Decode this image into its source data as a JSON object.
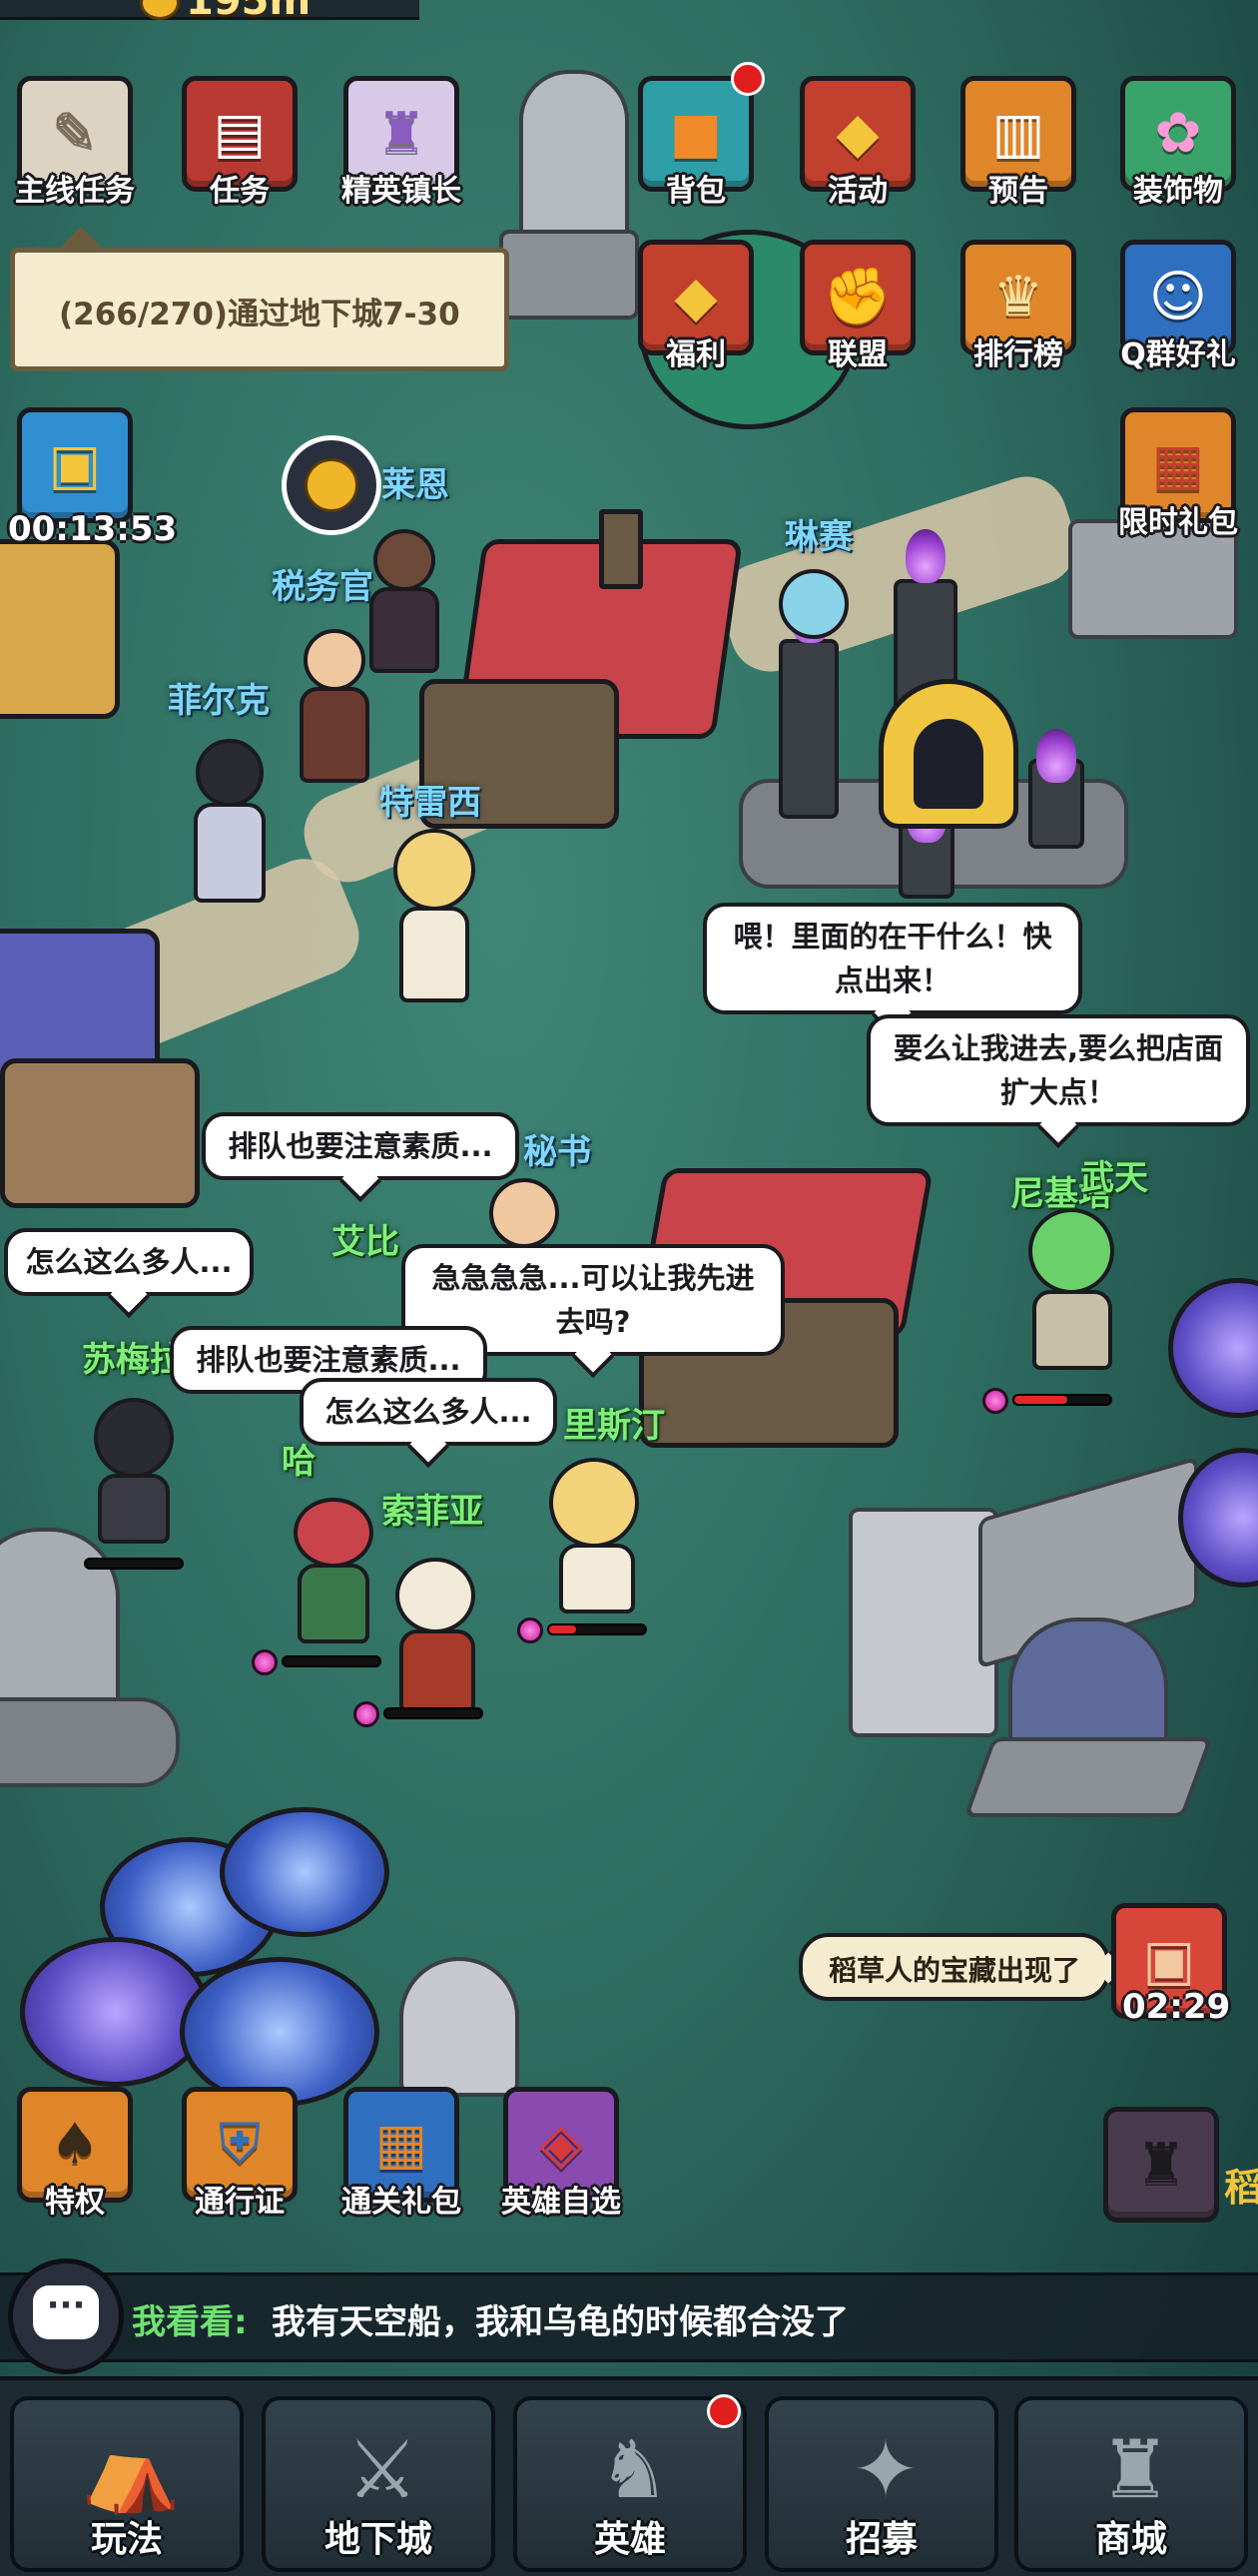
{
  "top_bar": {
    "currency_value": "195m",
    "currency_icon": "gold-coin-icon"
  },
  "left_top_buttons": [
    {
      "label": "主线任务",
      "icon": "quest-scroll-icon"
    },
    {
      "label": "任务",
      "icon": "red-book-icon"
    },
    {
      "label": "精英镇长",
      "icon": "elite-mayor-icon"
    }
  ],
  "quest_tooltip": "(266/270)通过地下城7-30",
  "chest_timer": {
    "icon": "treasure-chest-icon",
    "time": "00:13:53"
  },
  "right_buttons_row1": [
    {
      "label": "背包",
      "icon": "backpack-icon",
      "badge": true
    },
    {
      "label": "活动",
      "icon": "banner-shield-icon"
    },
    {
      "label": "预告",
      "icon": "open-book-icon"
    },
    {
      "label": "装饰物",
      "icon": "decoration-bush-icon"
    }
  ],
  "right_buttons_row2": [
    {
      "label": "福利",
      "icon": "welfare-banner-icon"
    },
    {
      "label": "联盟",
      "icon": "alliance-fist-icon"
    },
    {
      "label": "排行榜",
      "icon": "trophy-icon"
    },
    {
      "label": "Q群好礼",
      "icon": "qq-gift-icon"
    }
  ],
  "limited_gift": {
    "label": "限时礼包",
    "icon": "gift-box-icon"
  },
  "npc_names": {
    "tax_officer": "税务官",
    "laien": "莱恩",
    "lin_sai": "琳赛",
    "fei_er_ke": "菲尔克",
    "te_lei_xi": "特雷西",
    "secretary": "秘书",
    "ai_bi": "艾比",
    "su_mei_la": "苏梅拉",
    "suo_fei_ya": "索菲亚",
    "li_si_ting": "里斯汀",
    "ha": "哈",
    "ni_ji_ta": "尼基塔",
    "wu_tian": "武天"
  },
  "bubbles": {
    "shout_top": "喂！里面的在干什么！快点出来！",
    "expand_shop": "要么让我进去,要么把店面扩大点！",
    "queue_quality_1": "排队也要注意素质...",
    "so_many_1": "怎么这么多人...",
    "hurry": "急急急急...可以让我先进去吗?",
    "queue_quality_2": "排队也要注意素质...",
    "so_many_2": "怎么这么多人..."
  },
  "treasure_notice": {
    "text": "稻草人的宝藏出现了",
    "timer": "02:29",
    "icon": "red-chest-icon"
  },
  "bottom_left_buttons": [
    {
      "label": "特权",
      "icon": "privilege-card-icon"
    },
    {
      "label": "通行证",
      "icon": "pass-shield-icon"
    },
    {
      "label": "通关礼包",
      "icon": "clear-gift-icon"
    },
    {
      "label": "英雄自选",
      "icon": "hero-select-chest-icon"
    }
  ],
  "tower_button": {
    "icon": "castle-tower-icon",
    "side_text": "稻"
  },
  "chat": {
    "sender": "我看看:",
    "message": "我有天空船，我和乌龟的时候都合没了",
    "icon": "chat-bubble-icon"
  },
  "bottom_nav": [
    {
      "label": "玩法",
      "icon": "gameplay-tent-icon"
    },
    {
      "label": "地下城",
      "icon": "dungeon-icon"
    },
    {
      "label": "英雄",
      "icon": "hero-helmet-icon",
      "badge": true
    },
    {
      "label": "招募",
      "icon": "recruit-icon"
    },
    {
      "label": "商城",
      "icon": "shop-castle-icon"
    }
  ],
  "colors": {
    "tile_red": "#c2402e",
    "tile_orange": "#e0862a",
    "tile_blue": "#2f6fbf",
    "tile_green": "#3aa36a",
    "npc_label": "#7fd6ff",
    "chat_name": "#6fe26f"
  }
}
